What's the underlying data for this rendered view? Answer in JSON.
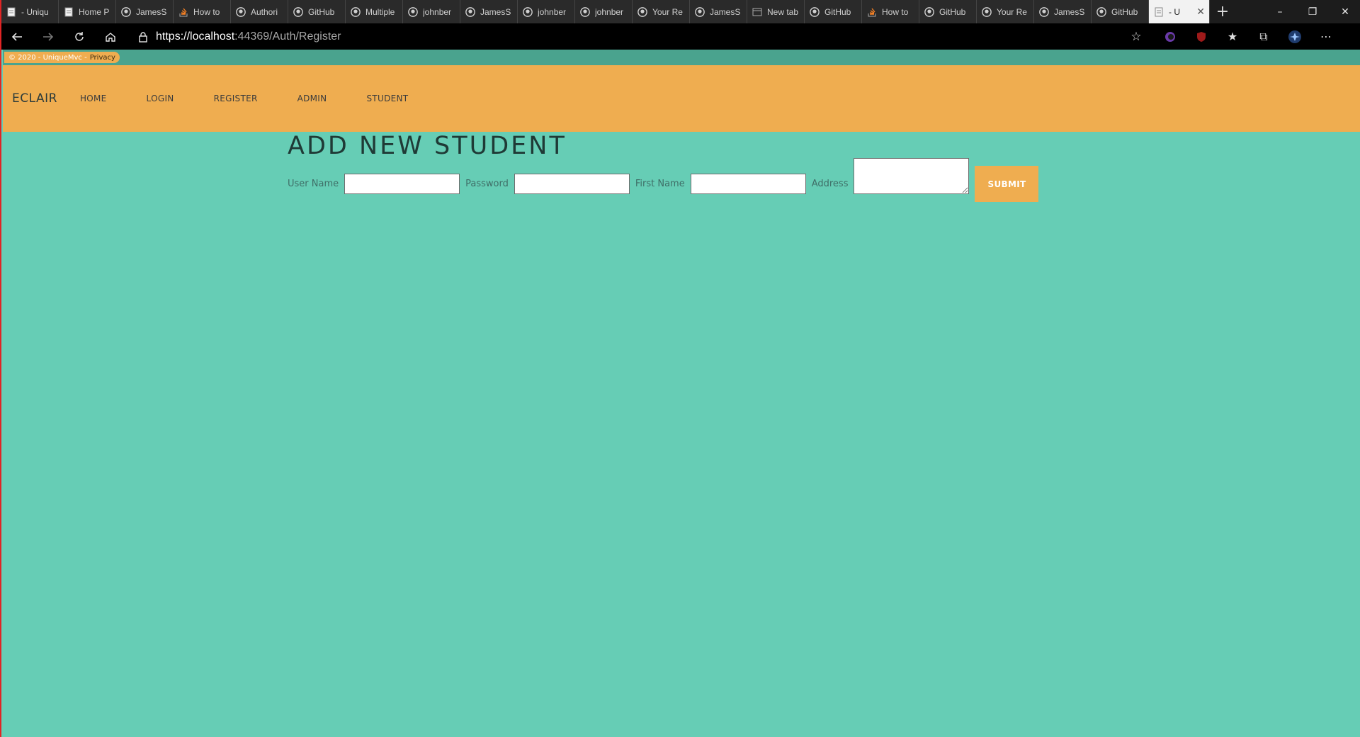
{
  "browser": {
    "tabs": [
      {
        "title": "- Uniqu",
        "icon": "page-icon"
      },
      {
        "title": "Home P",
        "icon": "page-icon"
      },
      {
        "title": "JamesS",
        "icon": "github-icon"
      },
      {
        "title": "How to",
        "icon": "stackoverflow-icon"
      },
      {
        "title": "Authori",
        "icon": "github-icon"
      },
      {
        "title": "GitHub",
        "icon": "github-icon"
      },
      {
        "title": "Multiple",
        "icon": "github-icon"
      },
      {
        "title": "johnber",
        "icon": "github-icon"
      },
      {
        "title": "JamesS",
        "icon": "github-icon"
      },
      {
        "title": "johnber",
        "icon": "github-icon"
      },
      {
        "title": "johnber",
        "icon": "github-icon"
      },
      {
        "title": "Your Re",
        "icon": "github-icon"
      },
      {
        "title": "JamesS",
        "icon": "github-icon"
      },
      {
        "title": "New tab",
        "icon": "newtab-icon"
      },
      {
        "title": "GitHub",
        "icon": "github-icon"
      },
      {
        "title": "How to",
        "icon": "stackoverflow-icon"
      },
      {
        "title": "GitHub",
        "icon": "github-icon"
      },
      {
        "title": "Your Re",
        "icon": "github-icon"
      },
      {
        "title": "JamesS",
        "icon": "github-icon"
      },
      {
        "title": "GitHub",
        "icon": "github-icon"
      },
      {
        "title": "- U",
        "icon": "page-icon",
        "active": true
      }
    ],
    "address": {
      "host": "https://localhost",
      "rest": ":44369/Auth/Register"
    }
  },
  "footer": {
    "copyright": "© 2020 - UniqueMvc -",
    "privacy": "Privacy"
  },
  "nav": {
    "brand": "ECLAIR",
    "links": [
      "HOME",
      "LOGIN",
      "REGISTER",
      "ADMIN",
      "STUDENT"
    ]
  },
  "form": {
    "heading": "ADD NEW STUDENT",
    "user_name_label": "User Name",
    "password_label": "Password",
    "first_name_label": "First Name",
    "address_label": "Address",
    "submit_label": "SUBMIT"
  },
  "colors": {
    "page_bg": "#66cdb5",
    "navbar_bg": "#efad50",
    "accent": "#efad50"
  }
}
